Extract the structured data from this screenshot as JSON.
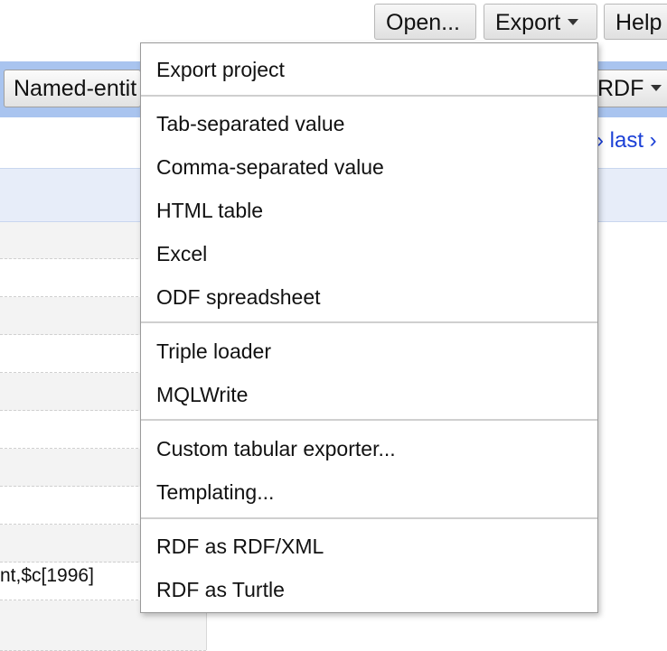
{
  "toolbar": {
    "open_label": "Open...",
    "export_label": "Export",
    "help_label": "Help"
  },
  "app": {
    "named_entity_button": "Named-entit",
    "rdf_button": "RDF",
    "pager_text": "› last ›",
    "cell_text": "nt,$c[1996]"
  },
  "menu": {
    "items": [
      "Export project",
      "Tab-separated value",
      "Comma-separated value",
      "HTML table",
      "Excel",
      "ODF spreadsheet",
      "Triple loader",
      "MQLWrite",
      "Custom tabular exporter...",
      "Templating...",
      "RDF as RDF/XML",
      "RDF as Turtle"
    ]
  },
  "colors": {
    "header_band": "#a9c4ef",
    "link": "#1a3fd6",
    "row_highlight": "#e7edf9"
  }
}
